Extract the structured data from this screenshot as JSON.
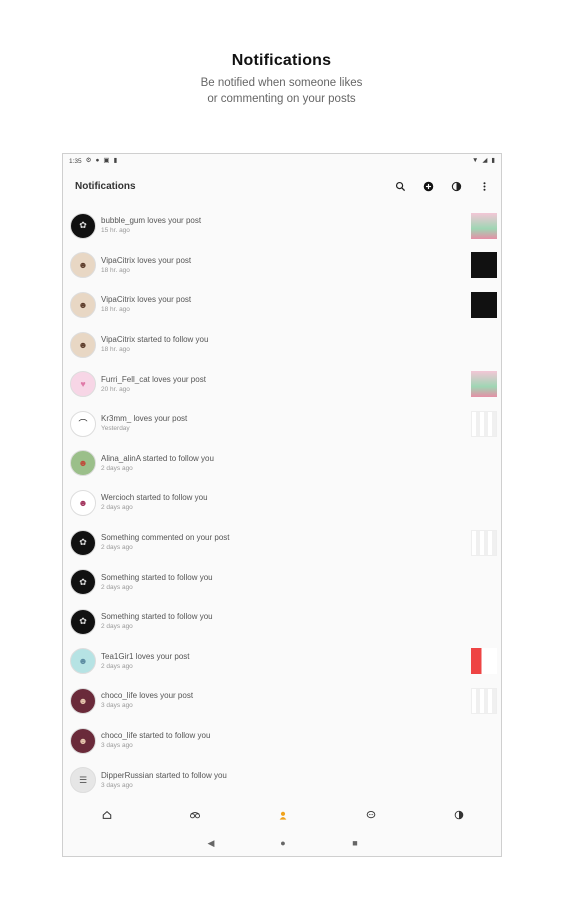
{
  "promo": {
    "title": "Notifications",
    "subtitle_line1": "Be notified when someone likes",
    "subtitle_line2": "or commenting on your posts"
  },
  "statusbar": {
    "time": "1:35",
    "left_icons": [
      "settings-icon",
      "location-icon",
      "image-icon",
      "clipboard-icon"
    ],
    "right_icons": [
      "wifi-icon",
      "signal-icon",
      "battery-icon"
    ]
  },
  "appbar": {
    "title": "Notifications",
    "actions": [
      "search-icon",
      "add-circle-icon",
      "contrast-icon",
      "more-vert-icon"
    ]
  },
  "notifications": [
    {
      "text": "bubble_gum loves your post",
      "time": "15 hr. ago",
      "avatar": "dark",
      "thumb": "pink"
    },
    {
      "text": "VipaCitrix loves your post",
      "time": "18 hr. ago",
      "avatar": "girl",
      "thumb": "black"
    },
    {
      "text": "VipaCitrix loves your post",
      "time": "18 hr. ago",
      "avatar": "girl",
      "thumb": "black"
    },
    {
      "text": "VipaCitrix started to follow you",
      "time": "18 hr. ago",
      "avatar": "girl",
      "thumb": ""
    },
    {
      "text": "Furri_Fell_cat loves your post",
      "time": "20 hr. ago",
      "avatar": "pink",
      "thumb": "pink"
    },
    {
      "text": "Kr3mm_ loves your post",
      "time": "Yesterday",
      "avatar": "bird",
      "thumb": "screen"
    },
    {
      "text": "Alina_alinA started to follow you",
      "time": "2 days ago",
      "avatar": "green",
      "thumb": ""
    },
    {
      "text": "Wercioch started to follow you",
      "time": "2 days ago",
      "avatar": "char",
      "thumb": ""
    },
    {
      "text": "Something commented on your post",
      "time": "2 days ago",
      "avatar": "dark",
      "thumb": "screen"
    },
    {
      "text": "Something started to follow you",
      "time": "2 days ago",
      "avatar": "dark",
      "thumb": ""
    },
    {
      "text": "Something started to follow you",
      "time": "2 days ago",
      "avatar": "dark",
      "thumb": ""
    },
    {
      "text": "Tea1Gir1 loves your post",
      "time": "2 days ago",
      "avatar": "teal",
      "thumb": "red"
    },
    {
      "text": "choco_life loves your post",
      "time": "3 days ago",
      "avatar": "maroon",
      "thumb": "screen"
    },
    {
      "text": "choco_life started to follow you",
      "time": "3 days ago",
      "avatar": "maroon",
      "thumb": ""
    },
    {
      "text": "DipperRussian started to follow you",
      "time": "3 days ago",
      "avatar": "sketch",
      "thumb": ""
    }
  ],
  "bottom_nav": [
    {
      "icon": "home-icon",
      "active": false
    },
    {
      "icon": "explore-icon",
      "active": false
    },
    {
      "icon": "notifications-icon",
      "active": true
    },
    {
      "icon": "chat-icon",
      "active": false
    },
    {
      "icon": "profile-icon",
      "active": false
    }
  ],
  "system_nav": [
    "back-icon",
    "home-circle-icon",
    "recents-icon"
  ],
  "colors": {
    "active_nav": "#f0a21c",
    "background": "#fafafa"
  }
}
